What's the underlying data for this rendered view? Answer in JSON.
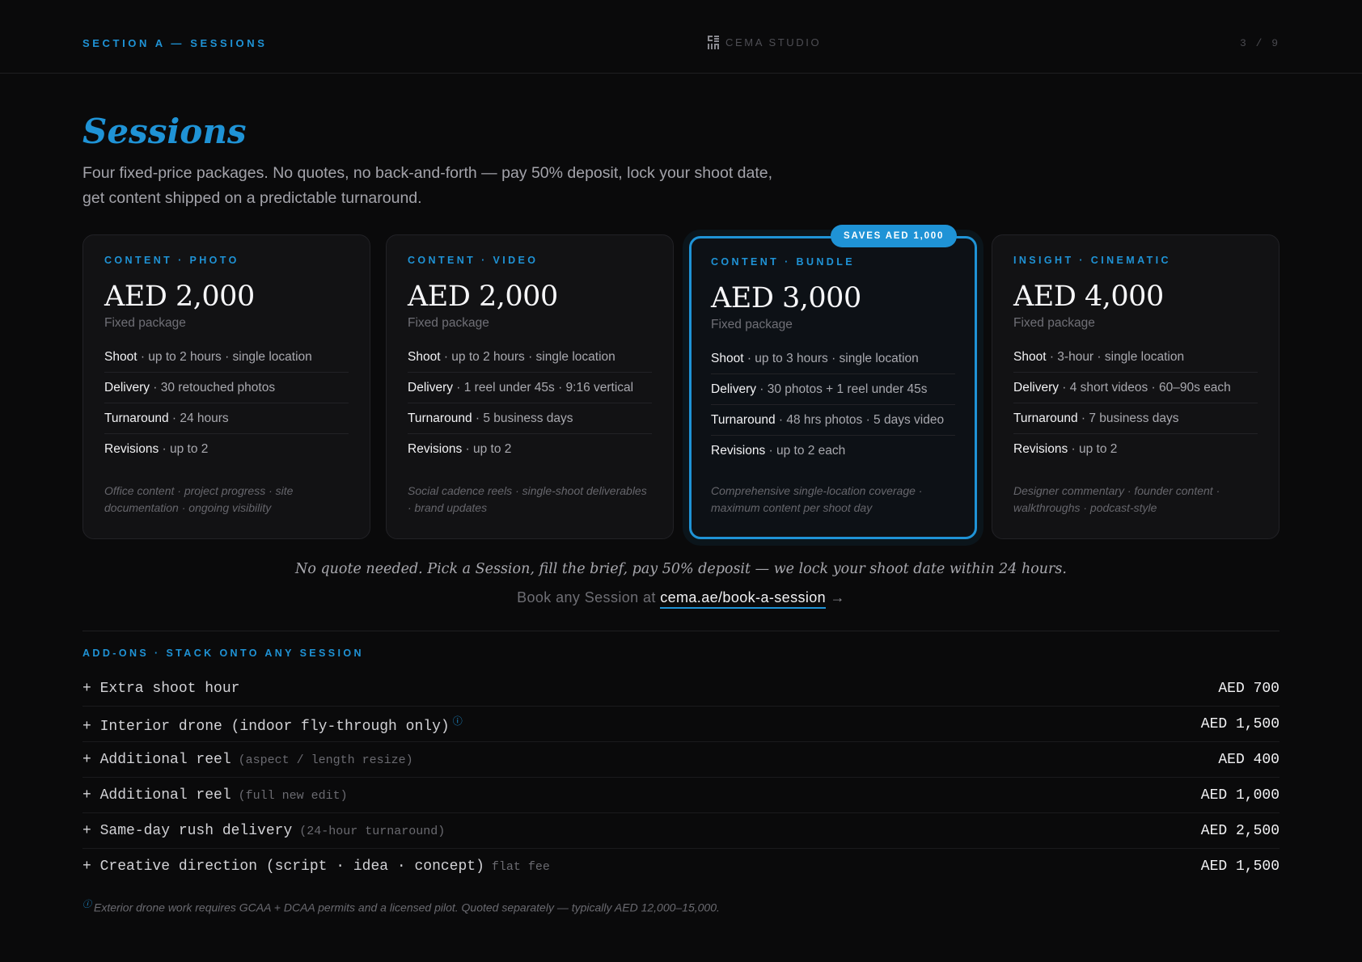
{
  "header": {
    "section": "SECTION A  —  SESSIONS",
    "brand": "CEMA STUDIO",
    "page": "3 / 9"
  },
  "title": "Sessions",
  "intro": "Four fixed-price packages. No quotes, no back-and-forth — pay 50% deposit, lock your shoot date, get content shipped on a predictable turnaround.",
  "cards": [
    {
      "category": "CONTENT · PHOTO",
      "price": "AED 2,000",
      "sub": "Fixed package",
      "specs": [
        {
          "k": "Shoot",
          "v": " · up to 2 hours · single location"
        },
        {
          "k": "Delivery",
          "v": " · 30 retouched photos"
        },
        {
          "k": "Turnaround",
          "v": " · 24 hours"
        },
        {
          "k": "Revisions",
          "v": " · up to 2"
        }
      ],
      "note": "Office content · project progress · site documentation · ongoing visibility"
    },
    {
      "category": "CONTENT · VIDEO",
      "price": "AED 2,000",
      "sub": "Fixed package",
      "specs": [
        {
          "k": "Shoot",
          "v": " · up to 2 hours · single location"
        },
        {
          "k": "Delivery",
          "v": " · 1 reel under 45s · 9:16 vertical"
        },
        {
          "k": "Turnaround",
          "v": " · 5 business days"
        },
        {
          "k": "Revisions",
          "v": " · up to 2"
        }
      ],
      "note": "Social cadence reels · single-shoot deliverables · brand updates"
    },
    {
      "category": "CONTENT · BUNDLE",
      "badge": "SAVES AED 1,000",
      "price": "AED 3,000",
      "sub": "Fixed package",
      "specs": [
        {
          "k": "Shoot",
          "v": " · up to 3 hours · single location"
        },
        {
          "k": "Delivery",
          "v": " · 30 photos + 1 reel under 45s"
        },
        {
          "k": "Turnaround",
          "v": " · 48 hrs photos · 5 days video"
        },
        {
          "k": "Revisions",
          "v": " · up to 2 each"
        }
      ],
      "note": "Comprehensive single-location coverage · maximum content per shoot day"
    },
    {
      "category": "INSIGHT · CINEMATIC",
      "price": "AED 4,000",
      "sub": "Fixed package",
      "specs": [
        {
          "k": "Shoot",
          "v": " · 3-hour · single location"
        },
        {
          "k": "Delivery",
          "v": " · 4 short videos · 60–90s each"
        },
        {
          "k": "Turnaround",
          "v": " · 7 business days"
        },
        {
          "k": "Revisions",
          "v": " · up to 2"
        }
      ],
      "note": "Designer commentary · founder content · walkthroughs · podcast-style"
    }
  ],
  "note_line": "No quote needed. Pick a Session, fill the brief, pay 50% deposit — we lock your shoot date within 24 hours.",
  "book": {
    "prefix": "Book any Session at ",
    "link": "cema.ae/book-a-session",
    "arrow": " →"
  },
  "addons": {
    "heading": "ADD-ONS  ·  STACK ONTO ANY SESSION",
    "items": [
      {
        "name": "+ Extra shoot hour",
        "extra": "",
        "price": "AED 700"
      },
      {
        "name": "+ Interior drone (indoor fly-through only)",
        "extra": "",
        "info": "ⓘ",
        "price": "AED 1,500"
      },
      {
        "name": "+ Additional reel",
        "extra": " (aspect / length resize)",
        "price": "AED 400"
      },
      {
        "name": "+ Additional reel",
        "extra": " (full new edit)",
        "price": "AED 1,000"
      },
      {
        "name": "+ Same-day rush delivery",
        "extra": " (24-hour turnaround)",
        "price": "AED 2,500"
      },
      {
        "name": "+ Creative direction (script · idea · concept)",
        "extra": " flat fee",
        "price": "AED 1,500"
      }
    ]
  },
  "footnote": {
    "icon": "ⓘ",
    "text": "Exterior drone work requires GCAA + DCAA permits and a licensed pilot. Quoted separately — typically AED 12,000–15,000."
  }
}
